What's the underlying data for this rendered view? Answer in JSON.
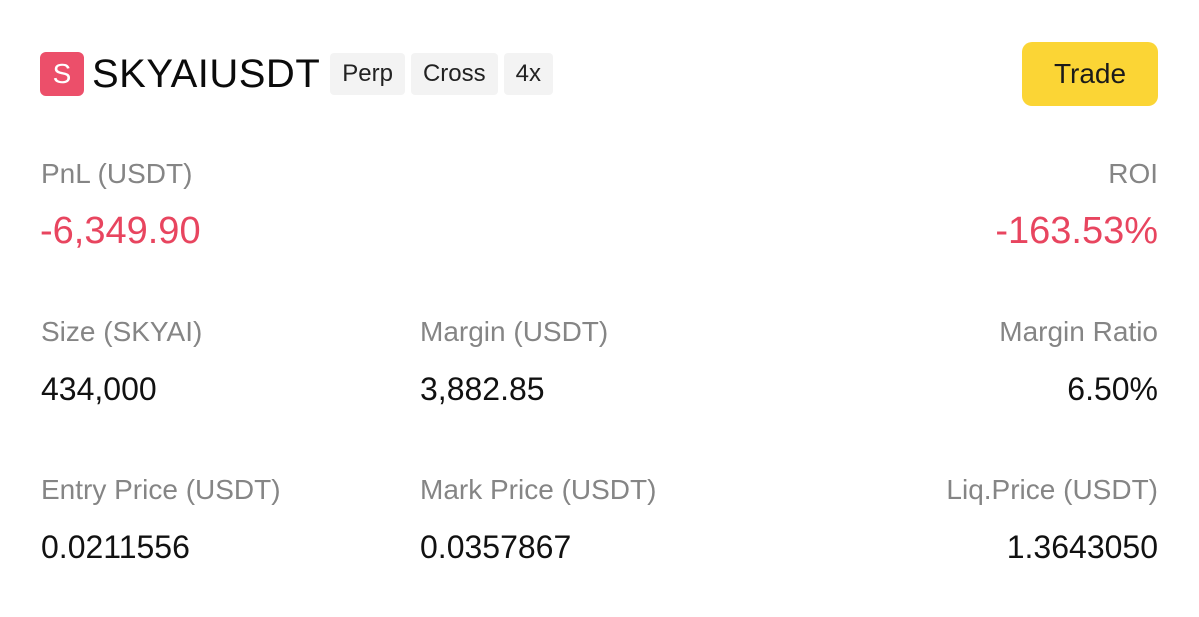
{
  "header": {
    "badge_letter": "S",
    "symbol": "SKYAIUSDT",
    "tags": [
      "Perp",
      "Cross",
      "4x"
    ],
    "trade_label": "Trade"
  },
  "pnl": {
    "label": "PnL (USDT)",
    "value": "-6,349.90"
  },
  "roi": {
    "label": "ROI",
    "value": "-163.53%"
  },
  "size": {
    "label": "Size (SKYAI)",
    "value": "434,000"
  },
  "margin": {
    "label": "Margin (USDT)",
    "value": "3,882.85"
  },
  "margin_ratio": {
    "label": "Margin Ratio",
    "value": "6.50%"
  },
  "entry_price": {
    "label": "Entry Price (USDT)",
    "value": "0.0211556"
  },
  "mark_price": {
    "label": "Mark Price (USDT)",
    "value": "0.0357867"
  },
  "liq_price": {
    "label": "Liq.Price (USDT)",
    "value": "1.3643050"
  },
  "colors": {
    "negative": "#e8455f",
    "badge": "#ec4f6a",
    "trade_button": "#fbd535",
    "label": "#858585"
  }
}
